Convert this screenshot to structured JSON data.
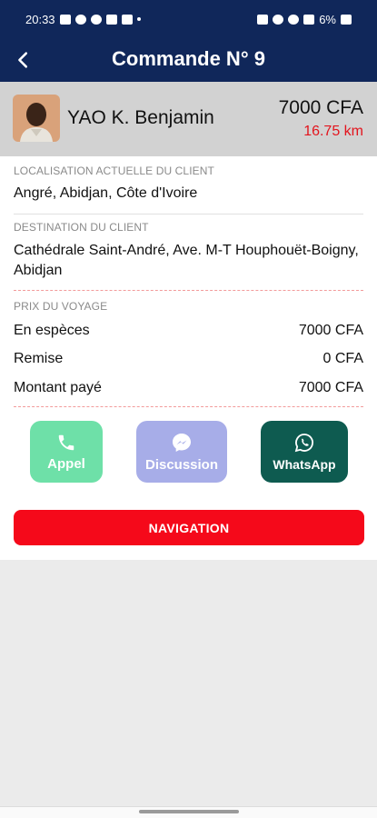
{
  "status_bar": {
    "time": "20:33",
    "battery": "6%"
  },
  "header": {
    "title": "Commande N° 9",
    "back_icon": "arrow-left-icon"
  },
  "client": {
    "name": "YAO K. Benjamin",
    "fare": "7000 CFA",
    "distance": "16.75 km"
  },
  "location": {
    "label": "LOCALISATION ACTUELLE DU CLIENT",
    "value": "Angré, Abidjan, Côte d'Ivoire"
  },
  "destination": {
    "label": "DESTINATION DU CLIENT",
    "value": "Cathédrale Saint-André, Ave. M-T Houphouët-Boigny, Abidjan"
  },
  "pricing": {
    "label": "PRIX DU VOYAGE",
    "rows": [
      {
        "label": "En espèces",
        "value": "7000 CFA"
      },
      {
        "label": "Remise",
        "value": "0 CFA"
      },
      {
        "label": "Montant payé",
        "value": "7000 CFA"
      }
    ]
  },
  "actions": {
    "call": {
      "label": "Appel",
      "icon": "phone-icon",
      "color": "#6ee0a8"
    },
    "chat": {
      "label": "Discussion",
      "icon": "messenger-icon",
      "color": "#a7ade8"
    },
    "whatsapp": {
      "label": "WhatsApp",
      "icon": "whatsapp-icon",
      "color": "#0e5b50"
    }
  },
  "navigation_button": {
    "label": "NAVIGATION",
    "color": "#f5091a"
  },
  "colors": {
    "primary": "#10275a",
    "accent": "#e3141d"
  }
}
